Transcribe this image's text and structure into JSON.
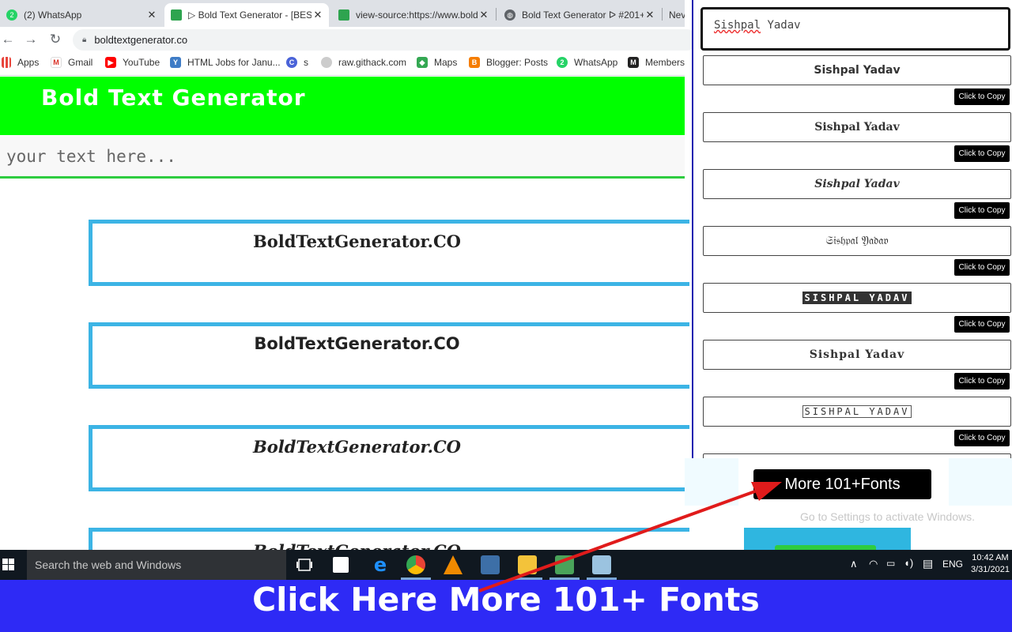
{
  "browser": {
    "tabs": [
      {
        "title": "(2) WhatsApp",
        "icon": "whatsapp-icon",
        "color": "#25d366"
      },
      {
        "title": "▷ Bold Text Generator - [BEST",
        "icon": "boldtext-icon",
        "color": "#2ea44f"
      },
      {
        "title": "view-source:https://www.bold",
        "icon": "boldtext-icon",
        "color": "#2ea44f"
      },
      {
        "title": "Bold Text Generator ᐅ #201+",
        "icon": "globe-icon",
        "color": "#5f6368"
      },
      {
        "title": "Nev",
        "icon": "",
        "color": ""
      }
    ],
    "url": "boldtextgenerator.co",
    "bookmarks": [
      {
        "label": "Apps",
        "icon": "apps-grid-icon"
      },
      {
        "label": "Gmail",
        "icon": "gmail-icon"
      },
      {
        "label": "YouTube",
        "icon": "youtube-icon"
      },
      {
        "label": "HTML Jobs for Janu...",
        "icon": "ycombinator-icon"
      },
      {
        "label": "s",
        "icon": "c-letter-icon"
      },
      {
        "label": "raw.githack.com",
        "icon": "githack-icon"
      },
      {
        "label": "Maps",
        "icon": "maps-icon"
      },
      {
        "label": "Blogger: Posts",
        "icon": "blogger-icon"
      },
      {
        "label": "WhatsApp",
        "icon": "whatsapp-icon"
      },
      {
        "label": "Members",
        "icon": "members-icon"
      }
    ]
  },
  "site": {
    "title": "Bold Text Generator",
    "input_placeholder": "your text here...",
    "outputs": [
      "BoldTextGenerator.CO",
      "BoldTextGenerator.CO",
      "BoldTextGenerator.CO",
      "BoldTextGenerator.CO"
    ]
  },
  "panel": {
    "input_value": "Sishpal Yadav",
    "input_first_word": "Sishpal",
    "input_rest": " Yadav",
    "fonts": [
      "Sishpal Yadav",
      "Sishpal Yadav",
      "Sishpal Yadav",
      "𝔖𝔦𝔰𝔥𝔭𝔞𝔩 𝔜𝔞𝔡𝔞𝔳",
      "SISHPAL YADAV",
      "Sishpal Yadav",
      "SISHPAL YADAV"
    ],
    "copy_label": "Click to Copy",
    "more_button": "More 101+Fonts"
  },
  "watermark": "Go to Settings to activate Windows.",
  "taskbar": {
    "search_placeholder": "Search the web and Windows",
    "language": "ENG",
    "time": "10:42 AM",
    "date": "3/31/2021"
  },
  "caption": "Click Here More 101+ Fonts",
  "colors": {
    "header_green": "#00ff00",
    "output_border": "#3cb4e5",
    "caption_blue": "#2e2af5",
    "arrow_red": "#e01b1b"
  }
}
